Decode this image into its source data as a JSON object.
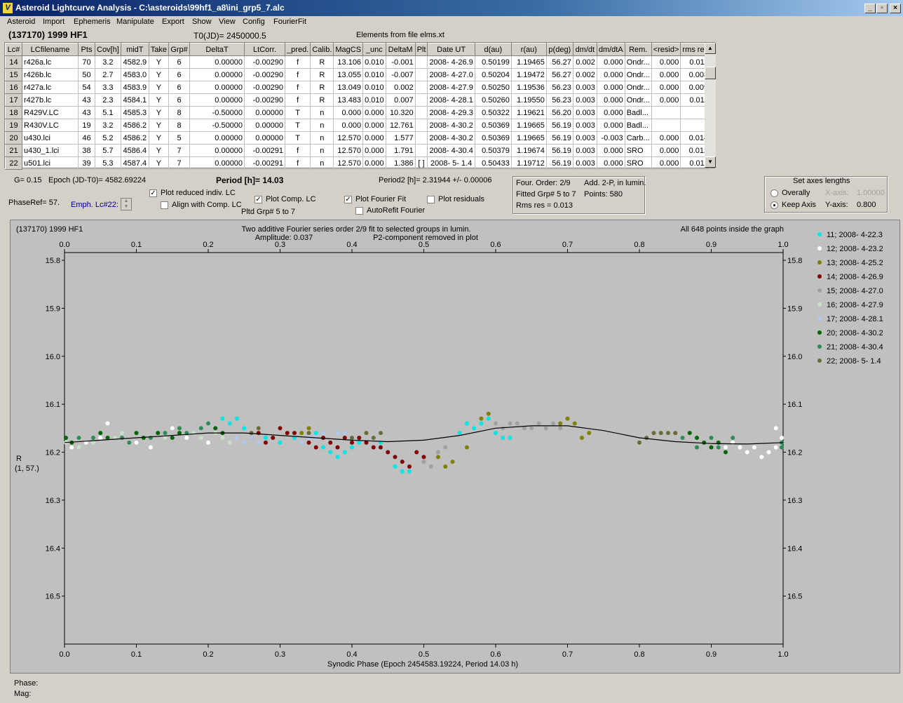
{
  "window": {
    "title": "Asteroid Lightcurve Analysis - C:\\asteroids\\99hf1_a8\\ini_grp5_7.alc",
    "icon_name": "app-logo-icon",
    "min_btn": "_",
    "max_btn": "▫",
    "close_btn": "×"
  },
  "menu": [
    "Asteroid",
    "Import",
    "Ephemeris",
    "Manipulate",
    "Export",
    "Show",
    "View",
    "Config",
    "FourierFit"
  ],
  "info": {
    "asteroid": "(137170) 1999 HF1",
    "t0": "T0(JD)= 2450000.5",
    "elements": "Elements from file elms.xt"
  },
  "table": {
    "columns": [
      "Lc#",
      "LCfilename",
      "Pts",
      "Cov[h]",
      "midT",
      "Take",
      "Grp#",
      "DeltaT",
      "LtCorr.",
      "_pred.",
      "Calib.",
      "MagCS",
      "_unc",
      "DeltaM",
      "Plt",
      "Date UT",
      "d(au)",
      "r(au)",
      "p(deg)",
      "dm/dt",
      "dm/dtA",
      "Rem.",
      "<resid>",
      "rms res"
    ],
    "rows": [
      [
        "14",
        "r426a.lc",
        "70",
        "3.2",
        "4582.9",
        "Y",
        "6",
        "0.00000",
        "-0.00290",
        "f",
        "R",
        "13.106",
        "0.010",
        "-0.001",
        "",
        "2008- 4-26.9",
        "0.50199",
        "1.19465",
        "56.27",
        "0.002",
        "0.000",
        "Ondr...",
        "0.000",
        "0.011"
      ],
      [
        "15",
        "r426b.lc",
        "50",
        "2.7",
        "4583.0",
        "Y",
        "6",
        "0.00000",
        "-0.00290",
        "f",
        "R",
        "13.055",
        "0.010",
        "-0.007",
        "",
        "2008- 4-27.0",
        "0.50204",
        "1.19472",
        "56.27",
        "0.002",
        "0.000",
        "Ondr...",
        "0.000",
        "0.008"
      ],
      [
        "16",
        "r427a.lc",
        "54",
        "3.3",
        "4583.9",
        "Y",
        "6",
        "0.00000",
        "-0.00290",
        "f",
        "R",
        "13.049",
        "0.010",
        "0.002",
        "",
        "2008- 4-27.9",
        "0.50250",
        "1.19536",
        "56.23",
        "0.003",
        "0.000",
        "Ondr...",
        "0.000",
        "0.009"
      ],
      [
        "17",
        "r427b.lc",
        "43",
        "2.3",
        "4584.1",
        "Y",
        "6",
        "0.00000",
        "-0.00290",
        "f",
        "R",
        "13.483",
        "0.010",
        "0.007",
        "",
        "2008- 4-28.1",
        "0.50260",
        "1.19550",
        "56.23",
        "0.003",
        "0.000",
        "Ondr...",
        "0.000",
        "0.011"
      ],
      [
        "18",
        "R429V.LC",
        "43",
        "5.1",
        "4585.3",
        "Y",
        "8",
        "-0.50000",
        "0.00000",
        "T",
        "n",
        "0.000",
        "0.000",
        "10.320",
        "",
        "2008- 4-29.3",
        "0.50322",
        "1.19621",
        "56.20",
        "0.003",
        "0.000",
        "Badl...",
        "",
        ""
      ],
      [
        "19",
        "R430V.LC",
        "19",
        "3.2",
        "4586.2",
        "Y",
        "8",
        "-0.50000",
        "0.00000",
        "T",
        "n",
        "0.000",
        "0.000",
        "12.761",
        "",
        "2008- 4-30.2",
        "0.50369",
        "1.19665",
        "56.19",
        "0.003",
        "0.000",
        "Badl...",
        "",
        ""
      ],
      [
        "20",
        "u430.lci",
        "46",
        "5.2",
        "4586.2",
        "Y",
        "5",
        "0.00000",
        "0.00000",
        "T",
        "n",
        "12.570",
        "0.000",
        "1.577",
        "",
        "2008- 4-30.2",
        "0.50369",
        "1.19665",
        "56.19",
        "0.003",
        "-0.003",
        "Carb...",
        "0.000",
        "0.014"
      ],
      [
        "21",
        "u430_1.lci",
        "38",
        "5.7",
        "4586.4",
        "Y",
        "7",
        "0.00000",
        "-0.00291",
        "f",
        "n",
        "12.570",
        "0.000",
        "1.791",
        "",
        "2008- 4-30.4",
        "0.50379",
        "1.19674",
        "56.19",
        "0.003",
        "0.000",
        "SRO",
        "0.000",
        "0.012"
      ],
      [
        "22",
        "u501.lci",
        "39",
        "5.3",
        "4587.4",
        "Y",
        "7",
        "0.00000",
        "-0.00291",
        "f",
        "n",
        "12.570",
        "0.000",
        "1.386",
        "[ ]",
        "2008- 5- 1.4",
        "0.50433",
        "1.19712",
        "56.19",
        "0.003",
        "0.000",
        "SRO",
        "0.000",
        "0.011"
      ]
    ]
  },
  "params": {
    "g": "G= 0.15",
    "epoch": "Epoch (JD-T0)= 4582.69224",
    "period": "Period [h]= 14.03",
    "period2": "Period2 [h]= 2.31944 +/- 0.00006",
    "phaseref": "PhaseRef= 57.",
    "emph": "Emph. Lc#22:",
    "pltd_grp": "Pltd Grp#  5  to  7"
  },
  "checkboxes": {
    "plot_reduced": {
      "label": "Plot reduced indiv. LC",
      "checked": true
    },
    "align_comp": {
      "label": "Align with Comp. LC",
      "checked": false
    },
    "plot_comp": {
      "label": "Plot Comp. LC",
      "checked": true
    },
    "plot_fourier": {
      "label": "Plot Fourier Fit",
      "checked": true
    },
    "plot_residuals": {
      "label": "Plot residuals",
      "checked": false
    },
    "autorefit": {
      "label": "AutoRefit Fourier",
      "checked": false
    }
  },
  "fourier_box": {
    "order": "Four. Order:  2/9",
    "add": "Add. 2-P, in lumin.",
    "fitted": "Fitted Grp# 5 to 7",
    "points": "Points: 580",
    "rms": "Rms res      = 0.013"
  },
  "axes_box": {
    "title": "Set axes lengths",
    "overally": "Overally",
    "keep_axis": "Keep Axis",
    "x_axis_label": "X-axis:",
    "x_axis_value": "1.00000",
    "y_axis_label": "Y-axis:",
    "y_axis_value": "0.800"
  },
  "chart_data": {
    "type": "scatter",
    "title_left": "(137170) 1999 HF1",
    "title_center_1": "Two additive Fourier series order 2/9 fit to selected groups in lumin.",
    "title_center_2": "Amplitude: 0.037",
    "title_center_3": "P2-component removed in plot",
    "title_right": "All 648 points inside the graph",
    "xlabel": "Synodic Phase (Epoch 2454583.19224, Period 14.03 h)",
    "ylabel_1": "R",
    "ylabel_2": "(1, 57.)",
    "xlim": [
      0,
      1
    ],
    "ylim": [
      16.6,
      15.8
    ],
    "xticks": [
      "0.0",
      "0.1",
      "0.2",
      "0.3",
      "0.4",
      "0.5",
      "0.6",
      "0.7",
      "0.8",
      "0.9",
      "1.0"
    ],
    "yticks": [
      "15.8",
      "15.9",
      "16.0",
      "16.1",
      "16.2",
      "16.3",
      "16.4",
      "16.5"
    ],
    "legend_position": "right",
    "series": [
      {
        "name": "11; 2008- 4-22.3",
        "color": "#00e5e5"
      },
      {
        "name": "12; 2008- 4-23.2",
        "color": "#ffffff"
      },
      {
        "name": "13; 2008- 4-25.2",
        "color": "#808000"
      },
      {
        "name": "14; 2008- 4-26.9",
        "color": "#800000"
      },
      {
        "name": "15; 2008- 4-27.0",
        "color": "#a0a0a0"
      },
      {
        "name": "16; 2008- 4-27.9",
        "color": "#c8e0c8"
      },
      {
        "name": "17; 2008- 4-28.1",
        "color": "#b0c8f0"
      },
      {
        "name": "20; 2008- 4-30.2",
        "color": "#006400"
      },
      {
        "name": "21; 2008- 4-30.4",
        "color": "#2e8b57"
      },
      {
        "name": "22; 2008- 5- 1.4",
        "color": "#6b6b3a"
      }
    ],
    "fit_curve": {
      "x": [
        0.0,
        0.05,
        0.1,
        0.15,
        0.2,
        0.25,
        0.3,
        0.35,
        0.4,
        0.45,
        0.5,
        0.55,
        0.6,
        0.65,
        0.7,
        0.75,
        0.8,
        0.85,
        0.9,
        0.95,
        1.0
      ],
      "y": [
        16.18,
        16.175,
        16.17,
        16.165,
        16.16,
        16.16,
        16.165,
        16.17,
        16.175,
        16.178,
        16.175,
        16.165,
        16.15,
        16.145,
        16.145,
        16.155,
        16.17,
        16.178,
        16.182,
        16.183,
        16.18
      ]
    },
    "points_by_series": {
      "11; 2008- 4-22.3": [
        [
          0.22,
          16.13
        ],
        [
          0.23,
          16.14
        ],
        [
          0.24,
          16.13
        ],
        [
          0.25,
          16.15
        ],
        [
          0.26,
          16.16
        ],
        [
          0.28,
          16.17
        ],
        [
          0.3,
          16.18
        ],
        [
          0.32,
          16.17
        ],
        [
          0.36,
          16.19
        ],
        [
          0.37,
          16.2
        ],
        [
          0.38,
          16.21
        ],
        [
          0.39,
          16.2
        ],
        [
          0.4,
          16.19
        ],
        [
          0.41,
          16.18
        ],
        [
          0.46,
          16.23
        ],
        [
          0.47,
          16.24
        ],
        [
          0.48,
          16.24
        ],
        [
          0.55,
          16.16
        ],
        [
          0.56,
          16.14
        ],
        [
          0.57,
          16.15
        ],
        [
          0.58,
          16.14
        ],
        [
          0.59,
          16.13
        ],
        [
          0.6,
          16.16
        ],
        [
          0.61,
          16.17
        ],
        [
          0.62,
          16.17
        ],
        [
          0.44,
          16.18
        ],
        [
          0.43,
          16.17
        ],
        [
          0.35,
          16.16
        ]
      ],
      "12; 2008- 4-23.2": [
        [
          0.01,
          16.19
        ],
        [
          0.03,
          16.18
        ],
        [
          0.05,
          16.17
        ],
        [
          0.06,
          16.14
        ],
        [
          0.1,
          16.18
        ],
        [
          0.12,
          16.19
        ],
        [
          0.15,
          16.15
        ],
        [
          0.17,
          16.17
        ],
        [
          0.2,
          16.18
        ],
        [
          0.94,
          16.19
        ],
        [
          0.95,
          16.2
        ],
        [
          0.96,
          16.19
        ],
        [
          0.97,
          16.21
        ],
        [
          0.98,
          16.2
        ],
        [
          0.99,
          16.19
        ],
        [
          1.0,
          16.17
        ],
        [
          0.99,
          16.15
        ],
        [
          0.93,
          16.18
        ],
        [
          0.92,
          16.19
        ]
      ],
      "13; 2008- 4-25.2": [
        [
          0.33,
          16.16
        ],
        [
          0.34,
          16.15
        ],
        [
          0.52,
          16.21
        ],
        [
          0.53,
          16.23
        ],
        [
          0.54,
          16.22
        ],
        [
          0.56,
          16.19
        ],
        [
          0.58,
          16.13
        ],
        [
          0.59,
          16.12
        ],
        [
          0.7,
          16.13
        ],
        [
          0.71,
          16.14
        ],
        [
          0.72,
          16.17
        ],
        [
          0.73,
          16.16
        ],
        [
          0.69,
          16.14
        ]
      ],
      "14; 2008- 4-26.9": [
        [
          0.26,
          16.17
        ],
        [
          0.27,
          16.16
        ],
        [
          0.28,
          16.18
        ],
        [
          0.29,
          16.17
        ],
        [
          0.3,
          16.15
        ],
        [
          0.31,
          16.16
        ],
        [
          0.32,
          16.16
        ],
        [
          0.34,
          16.18
        ],
        [
          0.35,
          16.19
        ],
        [
          0.36,
          16.17
        ],
        [
          0.37,
          16.18
        ],
        [
          0.38,
          16.19
        ],
        [
          0.39,
          16.17
        ],
        [
          0.4,
          16.18
        ],
        [
          0.41,
          16.17
        ],
        [
          0.42,
          16.18
        ],
        [
          0.43,
          16.19
        ],
        [
          0.44,
          16.19
        ],
        [
          0.45,
          16.2
        ],
        [
          0.46,
          16.21
        ],
        [
          0.47,
          16.22
        ],
        [
          0.48,
          16.23
        ],
        [
          0.49,
          16.2
        ],
        [
          0.5,
          16.21
        ]
      ],
      "15; 2008- 4-27.0": [
        [
          0.5,
          16.22
        ],
        [
          0.51,
          16.23
        ],
        [
          0.52,
          16.2
        ],
        [
          0.53,
          16.19
        ],
        [
          0.6,
          16.14
        ],
        [
          0.61,
          16.15
        ],
        [
          0.62,
          16.14
        ],
        [
          0.63,
          16.14
        ],
        [
          0.64,
          16.15
        ],
        [
          0.65,
          16.15
        ],
        [
          0.66,
          16.14
        ],
        [
          0.67,
          16.15
        ],
        [
          0.68,
          16.14
        ],
        [
          0.69,
          16.15
        ]
      ],
      "16; 2008- 4-27.9": [
        [
          0.0,
          16.18
        ],
        [
          0.02,
          16.19
        ],
        [
          0.04,
          16.18
        ],
        [
          0.07,
          16.17
        ],
        [
          0.08,
          16.16
        ],
        [
          0.14,
          16.17
        ],
        [
          0.18,
          16.16
        ],
        [
          0.19,
          16.17
        ],
        [
          0.21,
          16.16
        ],
        [
          0.22,
          16.17
        ],
        [
          0.23,
          16.18
        ]
      ],
      "17; 2008- 4-28.1": [
        [
          0.24,
          16.17
        ],
        [
          0.25,
          16.18
        ],
        [
          0.26,
          16.17
        ],
        [
          0.27,
          16.18
        ],
        [
          0.33,
          16.18
        ],
        [
          0.34,
          16.17
        ],
        [
          0.35,
          16.17
        ],
        [
          0.36,
          16.16
        ],
        [
          0.38,
          16.16
        ],
        [
          0.39,
          16.16
        ]
      ],
      "20; 2008- 4-30.2": [
        [
          0.0,
          16.17
        ],
        [
          0.01,
          16.18
        ],
        [
          0.05,
          16.16
        ],
        [
          0.06,
          16.17
        ],
        [
          0.1,
          16.16
        ],
        [
          0.11,
          16.17
        ],
        [
          0.13,
          16.16
        ],
        [
          0.15,
          16.17
        ],
        [
          0.16,
          16.16
        ],
        [
          0.21,
          16.15
        ],
        [
          0.22,
          16.16
        ],
        [
          0.87,
          16.16
        ],
        [
          0.88,
          16.17
        ],
        [
          0.89,
          16.18
        ],
        [
          0.9,
          16.19
        ],
        [
          0.91,
          16.18
        ],
        [
          0.92,
          16.2
        ]
      ],
      "21; 2008- 4-30.4": [
        [
          0.02,
          16.17
        ],
        [
          0.04,
          16.17
        ],
        [
          0.08,
          16.17
        ],
        [
          0.09,
          16.18
        ],
        [
          0.12,
          16.17
        ],
        [
          0.14,
          16.16
        ],
        [
          0.16,
          16.15
        ],
        [
          0.17,
          16.16
        ],
        [
          0.19,
          16.15
        ],
        [
          0.2,
          16.14
        ],
        [
          0.86,
          16.17
        ],
        [
          0.88,
          16.19
        ],
        [
          0.9,
          16.17
        ],
        [
          0.91,
          16.19
        ],
        [
          0.93,
          16.17
        ],
        [
          1.0,
          16.18
        ],
        [
          1.01,
          16.19
        ]
      ],
      "22; 2008- 5- 1.4": [
        [
          0.26,
          16.16
        ],
        [
          0.27,
          16.15
        ],
        [
          0.34,
          16.16
        ],
        [
          0.4,
          16.17
        ],
        [
          0.42,
          16.16
        ],
        [
          0.43,
          16.17
        ],
        [
          0.44,
          16.16
        ],
        [
          0.8,
          16.18
        ],
        [
          0.81,
          16.17
        ],
        [
          0.82,
          16.16
        ],
        [
          0.83,
          16.16
        ],
        [
          0.84,
          16.16
        ],
        [
          0.85,
          16.16
        ]
      ]
    }
  },
  "status": {
    "phase": "Phase:",
    "mag": "Mag:"
  }
}
